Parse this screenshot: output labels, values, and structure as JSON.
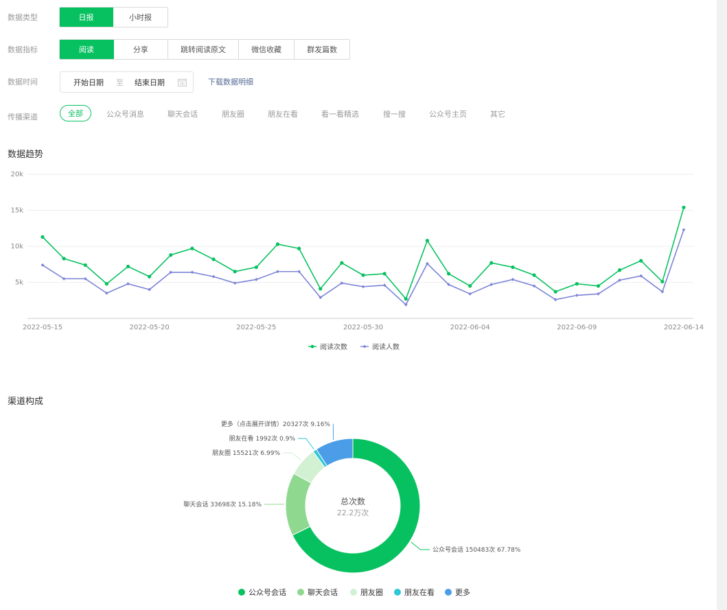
{
  "filters": {
    "data_type": {
      "label": "数据类型",
      "options": [
        "日报",
        "小时报"
      ],
      "selected": 0
    },
    "data_metric": {
      "label": "数据指标",
      "options": [
        "阅读",
        "分享",
        "跳转阅读原文",
        "微信收藏",
        "群发篇数"
      ],
      "selected": 0
    },
    "data_time": {
      "label": "数据时间",
      "start_placeholder": "开始日期",
      "separator": "至",
      "end_placeholder": "结束日期",
      "calendar_icon": "calendar-icon"
    },
    "download_link": "下载数据明细",
    "channel": {
      "label": "传播渠道",
      "options": [
        "全部",
        "公众号消息",
        "聊天会话",
        "朋友圈",
        "朋友在看",
        "看一看精选",
        "搜一搜",
        "公众号主页",
        "其它"
      ],
      "selected": 0
    }
  },
  "trend": {
    "title": "数据趋势"
  },
  "composition": {
    "title": "渠道构成",
    "center_label": "总次数",
    "center_value": "22.2万次"
  },
  "colors": {
    "accent": "#07c160",
    "series_reads": "#07c160",
    "series_readers": "#7b83d6",
    "slice_colors": [
      "#07c160",
      "#8fd88f",
      "#d2f0d2",
      "#2ec7d7",
      "#4a9de6"
    ]
  },
  "chart_data": [
    {
      "type": "line",
      "x": [
        "2022-05-15",
        "2022-05-16",
        "2022-05-17",
        "2022-05-18",
        "2022-05-19",
        "2022-05-20",
        "2022-05-21",
        "2022-05-22",
        "2022-05-23",
        "2022-05-24",
        "2022-05-25",
        "2022-05-26",
        "2022-05-27",
        "2022-05-28",
        "2022-05-29",
        "2022-05-30",
        "2022-05-31",
        "2022-06-01",
        "2022-06-02",
        "2022-06-03",
        "2022-06-04",
        "2022-06-05",
        "2022-06-06",
        "2022-06-07",
        "2022-06-08",
        "2022-06-09",
        "2022-06-10",
        "2022-06-11",
        "2022-06-12",
        "2022-06-13",
        "2022-06-14"
      ],
      "x_tick_labels": [
        "2022-05-15",
        "2022-05-20",
        "2022-05-25",
        "2022-05-30",
        "2022-06-04",
        "2022-06-09",
        "2022-06-14"
      ],
      "y_tick_labels": [
        "5k",
        "10k",
        "15k",
        "20k"
      ],
      "ylim": [
        0,
        20000
      ],
      "grid": true,
      "legend_position": "bottom",
      "series": [
        {
          "name": "阅读次数",
          "values": [
            11300,
            8300,
            7400,
            4800,
            7200,
            5800,
            8800,
            9700,
            8200,
            6500,
            7100,
            10300,
            9700,
            4100,
            7700,
            6000,
            6200,
            2700,
            10800,
            6200,
            4500,
            7700,
            7100,
            6000,
            3700,
            4800,
            4500,
            6700,
            8000,
            5100,
            15400
          ]
        },
        {
          "name": "阅读人数",
          "values": [
            7400,
            5500,
            5500,
            3500,
            4800,
            4000,
            6400,
            6400,
            5800,
            4900,
            5400,
            6500,
            6500,
            2900,
            4900,
            4400,
            4600,
            1900,
            7600,
            4700,
            3400,
            4700,
            5400,
            4500,
            2600,
            3200,
            3400,
            5300,
            5900,
            3700,
            12300
          ]
        }
      ]
    },
    {
      "type": "pie",
      "categories": [
        "公众号会话",
        "聊天会话",
        "朋友圈",
        "朋友在看",
        "更多"
      ],
      "slice_labels": [
        "公众号会话 150483次 67.78%",
        "聊天会话 33698次 15.18%",
        "朋友圈 15521次 6.99%",
        "朋友在看 1992次 0.9%",
        "更多（点击展开详情）20327次 9.16%"
      ],
      "values": [
        150483,
        33698,
        15521,
        1992,
        20327
      ],
      "percentages": [
        67.78,
        15.18,
        6.99,
        0.9,
        9.16
      ],
      "legend_position": "bottom"
    }
  ]
}
